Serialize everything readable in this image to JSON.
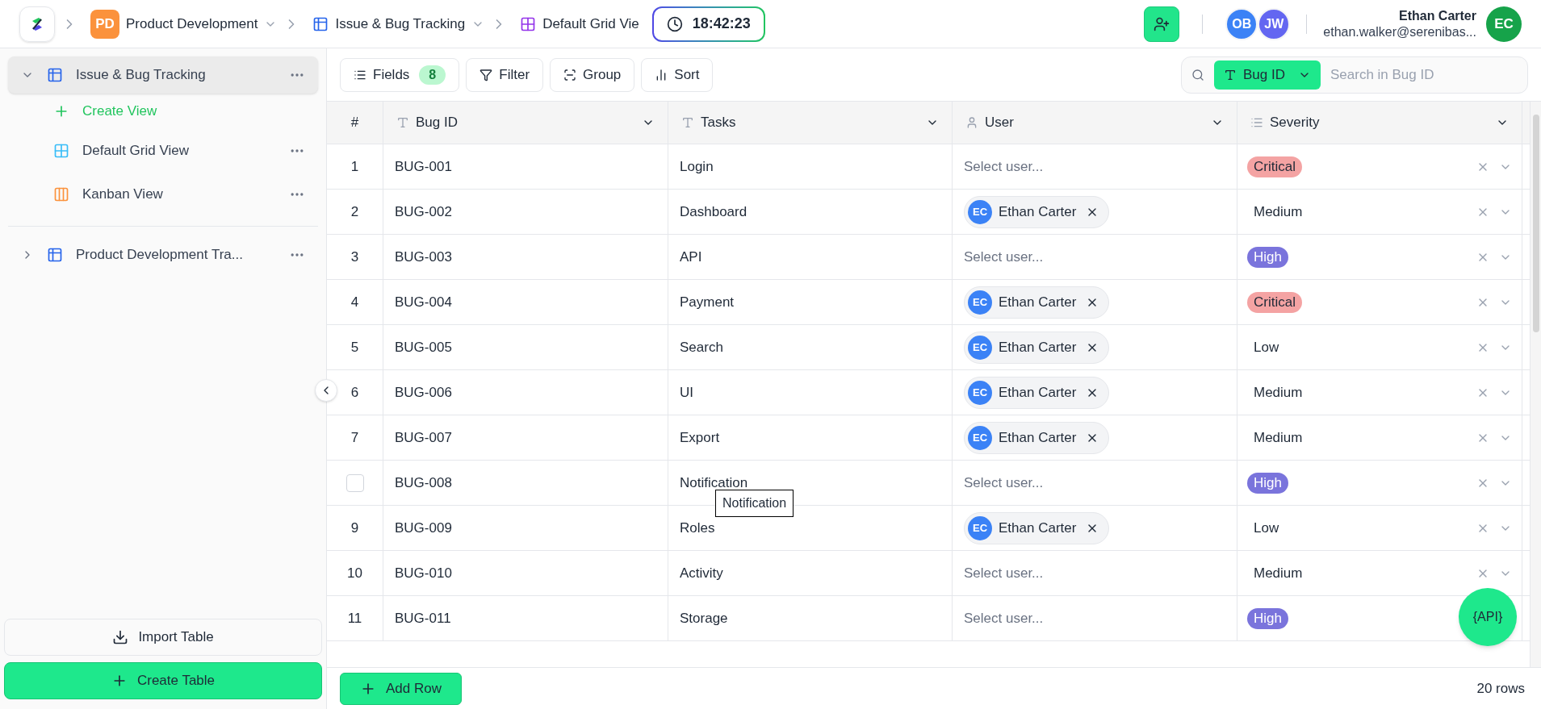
{
  "breadcrumbs": [
    {
      "kind": "workspace",
      "badge": "PD",
      "label": "Product Development",
      "dropdown": true
    },
    {
      "kind": "table",
      "label": "Issue & Bug Tracking",
      "dropdown": true
    },
    {
      "kind": "view",
      "label": "Default Grid Vie",
      "dropdown": false
    }
  ],
  "timer": "18:42:23",
  "collaborators": [
    {
      "initials": "OB",
      "color": "#3b82f6"
    },
    {
      "initials": "JW",
      "color": "#6366f1"
    }
  ],
  "account": {
    "name": "Ethan Carter",
    "email": "ethan.walker@serenibas...",
    "initials": "EC"
  },
  "sidebar": {
    "items": [
      {
        "kind": "table",
        "label": "Issue & Bug Tracking",
        "expanded": true,
        "selected": true,
        "children": [
          {
            "kind": "create",
            "label": "Create View"
          },
          {
            "kind": "grid",
            "label": "Default Grid View"
          },
          {
            "kind": "kanban",
            "label": "Kanban View"
          }
        ]
      },
      {
        "kind": "table",
        "label": "Product Development Tra...",
        "expanded": false,
        "selected": false
      }
    ],
    "import_button": "Import Table",
    "create_button": "Create Table"
  },
  "toolbar": {
    "buttons": [
      {
        "kind": "fields",
        "label": "Fields",
        "count": "8"
      },
      {
        "kind": "filter",
        "label": "Filter"
      },
      {
        "kind": "group",
        "label": "Group"
      },
      {
        "kind": "sort",
        "label": "Sort"
      }
    ],
    "search": {
      "field": "Bug ID",
      "placeholder": "Search in Bug ID"
    }
  },
  "table": {
    "columns": [
      {
        "kind": "index",
        "label": "#"
      },
      {
        "kind": "text",
        "label": "Bug ID"
      },
      {
        "kind": "text",
        "label": "Tasks"
      },
      {
        "kind": "user",
        "label": "User"
      },
      {
        "kind": "select",
        "label": "Severity"
      }
    ],
    "rows": [
      {
        "index": {
          "kind": "number",
          "text": "1"
        },
        "bug_id": "BUG-001",
        "task": "Login",
        "user": null,
        "user_placeholder": "Select user...",
        "severity": {
          "label": "Critical",
          "color": "#f4a3a3"
        }
      },
      {
        "index": {
          "kind": "number",
          "text": "2"
        },
        "bug_id": "BUG-002",
        "task": "Dashboard",
        "user": {
          "initials": "EC",
          "name": "Ethan Carter"
        },
        "severity": {
          "label": "Medium"
        }
      },
      {
        "index": {
          "kind": "number",
          "text": "3"
        },
        "bug_id": "BUG-003",
        "task": "API",
        "user": null,
        "user_placeholder": "Select user...",
        "severity": {
          "label": "High",
          "color": "#7a74dc"
        }
      },
      {
        "index": {
          "kind": "number",
          "text": "4"
        },
        "bug_id": "BUG-004",
        "task": "Payment",
        "user": {
          "initials": "EC",
          "name": "Ethan Carter"
        },
        "severity": {
          "label": "Critical",
          "color": "#f4a3a3"
        }
      },
      {
        "index": {
          "kind": "number",
          "text": "5"
        },
        "bug_id": "BUG-005",
        "task": "Search",
        "user": {
          "initials": "EC",
          "name": "Ethan Carter"
        },
        "severity": {
          "label": "Low"
        }
      },
      {
        "index": {
          "kind": "number",
          "text": "6"
        },
        "bug_id": "BUG-006",
        "task": "UI",
        "user": {
          "initials": "EC",
          "name": "Ethan Carter"
        },
        "severity": {
          "label": "Medium"
        }
      },
      {
        "index": {
          "kind": "number",
          "text": "7"
        },
        "bug_id": "BUG-007",
        "task": "Export",
        "user": {
          "initials": "EC",
          "name": "Ethan Carter"
        },
        "severity": {
          "label": "Medium"
        }
      },
      {
        "index": {
          "kind": "checkbox",
          "checked": false
        },
        "bug_id": "BUG-008",
        "task": "Notification",
        "tooltip": "Notification",
        "user": null,
        "user_placeholder": "Select user...",
        "severity": {
          "label": "High",
          "color": "#7a74dc"
        }
      },
      {
        "index": {
          "kind": "number",
          "text": "9"
        },
        "bug_id": "BUG-009",
        "task": "Roles",
        "user": {
          "initials": "EC",
          "name": "Ethan Carter"
        },
        "severity": {
          "label": "Low"
        }
      },
      {
        "index": {
          "kind": "number",
          "text": "10"
        },
        "bug_id": "BUG-010",
        "task": "Activity",
        "user": null,
        "user_placeholder": "Select user...",
        "severity": {
          "label": "Medium"
        }
      },
      {
        "index": {
          "kind": "number",
          "text": "11"
        },
        "bug_id": "BUG-011",
        "task": "Storage",
        "user": null,
        "user_placeholder": "Select user...",
        "severity": {
          "label": "High",
          "color": "#7a74dc"
        }
      }
    ]
  },
  "footer": {
    "add_button": "Add Row",
    "row_count": "20 rows"
  },
  "api_button": "{API}"
}
